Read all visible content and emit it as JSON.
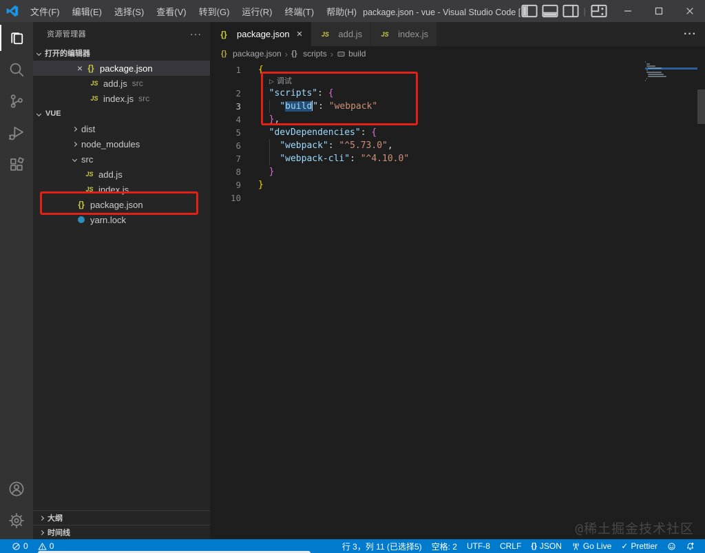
{
  "window": {
    "title": "package.json - vue - Visual Studio Code [管理员]"
  },
  "title_bar": {
    "menus": [
      {
        "key": "file",
        "label": "文件(F)"
      },
      {
        "key": "edit",
        "label": "编辑(E)"
      },
      {
        "key": "selection",
        "label": "选择(S)"
      },
      {
        "key": "view",
        "label": "查看(V)"
      },
      {
        "key": "go",
        "label": "转到(G)"
      },
      {
        "key": "run",
        "label": "运行(R)"
      },
      {
        "key": "terminal",
        "label": "终端(T)"
      },
      {
        "key": "help",
        "label": "帮助(H)"
      }
    ],
    "layout_icons": [
      "layout-sidebar-left-icon",
      "layout-panel-icon",
      "layout-sidebar-right-icon",
      "separator",
      "layout-customize-icon"
    ],
    "window_controls": [
      {
        "name": "minimize-button",
        "icon": "minimize-icon"
      },
      {
        "name": "maximize-button",
        "icon": "maximize-icon"
      },
      {
        "name": "close-button",
        "icon": "window-close-icon"
      }
    ]
  },
  "activity_bar": {
    "top": [
      {
        "name": "explorer",
        "icon": "files-icon",
        "active": true
      },
      {
        "name": "search",
        "icon": "search-icon",
        "active": false
      },
      {
        "name": "source-control",
        "icon": "source-control-icon",
        "active": false
      },
      {
        "name": "run-debug",
        "icon": "debug-icon",
        "active": false
      },
      {
        "name": "extensions",
        "icon": "extensions-icon",
        "active": false
      }
    ],
    "bottom": [
      {
        "name": "accounts",
        "icon": "account-icon"
      },
      {
        "name": "settings",
        "icon": "gear-icon"
      }
    ]
  },
  "sidebar": {
    "title": "资源管理器",
    "more_label": "···",
    "open_editors": {
      "header": "打开的编辑器",
      "items": [
        {
          "icon": "json",
          "label": "package.json",
          "selected": true,
          "closable": true,
          "desc": ""
        },
        {
          "icon": "js",
          "label": "add.js",
          "selected": false,
          "closable": false,
          "desc": "src"
        },
        {
          "icon": "js",
          "label": "index.js",
          "selected": false,
          "closable": false,
          "desc": "src"
        }
      ]
    },
    "tree": {
      "header": "VUE",
      "items": [
        {
          "kind": "folder",
          "label": "dist",
          "expanded": false,
          "level": 0
        },
        {
          "kind": "folder",
          "label": "node_modules",
          "expanded": false,
          "level": 0
        },
        {
          "kind": "folder",
          "label": "src",
          "expanded": true,
          "level": 0
        },
        {
          "kind": "file",
          "icon": "js",
          "label": "add.js",
          "level": 1
        },
        {
          "kind": "file",
          "icon": "js",
          "label": "index.js",
          "level": 1
        },
        {
          "kind": "file",
          "icon": "json",
          "label": "package.json",
          "level": 0,
          "annotated": true
        },
        {
          "kind": "file",
          "icon": "yarn",
          "label": "yarn.lock",
          "level": 0
        }
      ]
    },
    "bottom_sections": [
      {
        "label": "大纲"
      },
      {
        "label": "时间线"
      }
    ]
  },
  "editor": {
    "tabs": [
      {
        "icon": "json",
        "label": "package.json",
        "active": true,
        "closable": true
      },
      {
        "icon": "js",
        "label": "add.js",
        "active": false,
        "closable": false
      },
      {
        "icon": "js",
        "label": "index.js",
        "active": false,
        "closable": false
      }
    ],
    "tab_actions": [
      "split-editor-icon",
      "more-actions-icon"
    ],
    "breadcrumb": [
      {
        "icon": "json-icon",
        "label": "package.json"
      },
      {
        "icon": "object-icon",
        "label": "scripts"
      },
      {
        "icon": "symbol-icon",
        "label": "build"
      }
    ],
    "codelens": {
      "icon": "play-icon",
      "label": "调试"
    },
    "code_lines": [
      {
        "num": 1,
        "tokens": [
          {
            "t": "{",
            "c": "b1"
          }
        ]
      },
      {
        "num": 2,
        "tokens": [
          {
            "t": "  "
          },
          {
            "t": "\"scripts\"",
            "c": "key"
          },
          {
            "t": ": "
          },
          {
            "t": "{",
            "c": "b2"
          }
        ]
      },
      {
        "num": 3,
        "active": true,
        "guide": true,
        "tokens": [
          {
            "t": "    "
          },
          {
            "t": "\"",
            "c": "key"
          },
          {
            "t": "build",
            "c": "key",
            "sel": true
          },
          {
            "t": "",
            "caret": true
          },
          {
            "t": "\"",
            "c": "key"
          },
          {
            "t": ": "
          },
          {
            "t": "\"webpack\"",
            "c": "str"
          }
        ]
      },
      {
        "num": 4,
        "tokens": [
          {
            "t": "  "
          },
          {
            "t": "}",
            "c": "b2"
          },
          {
            "t": ","
          }
        ]
      },
      {
        "num": 5,
        "tokens": [
          {
            "t": "  "
          },
          {
            "t": "\"devDependencies\"",
            "c": "key"
          },
          {
            "t": ": "
          },
          {
            "t": "{",
            "c": "b2"
          }
        ]
      },
      {
        "num": 6,
        "guide": true,
        "tokens": [
          {
            "t": "    "
          },
          {
            "t": "\"webpack\"",
            "c": "key"
          },
          {
            "t": ": "
          },
          {
            "t": "\"^5.73.0\"",
            "c": "str"
          },
          {
            "t": ","
          }
        ]
      },
      {
        "num": 7,
        "guide": true,
        "tokens": [
          {
            "t": "    "
          },
          {
            "t": "\"webpack-cli\"",
            "c": "key"
          },
          {
            "t": ": "
          },
          {
            "t": "\"^4.10.0\"",
            "c": "str"
          }
        ]
      },
      {
        "num": 8,
        "tokens": [
          {
            "t": "  "
          },
          {
            "t": "}",
            "c": "b2"
          }
        ]
      },
      {
        "num": 9,
        "tokens": [
          {
            "t": "}",
            "c": "b1"
          }
        ]
      },
      {
        "num": 10,
        "tokens": []
      }
    ],
    "watermark": "@稀土掘金技术社区"
  },
  "status_bar": {
    "left": [
      {
        "name": "problems-errors",
        "icon": "error-icon",
        "label": "0"
      },
      {
        "name": "problems-warnings",
        "icon": "warning-icon",
        "label": "0"
      }
    ],
    "right": [
      {
        "name": "cursor-position",
        "icon": "",
        "label": "行 3，列 11 (已选择5)"
      },
      {
        "name": "indentation",
        "icon": "",
        "label": "空格: 2"
      },
      {
        "name": "encoding",
        "icon": "",
        "label": "UTF-8"
      },
      {
        "name": "eol",
        "icon": "",
        "label": "CRLF"
      },
      {
        "name": "language-mode",
        "icon": "braces-icon",
        "label": "JSON"
      },
      {
        "name": "go-live",
        "icon": "broadcast-icon",
        "label": "Go Live"
      },
      {
        "name": "prettier",
        "icon": "check-icon",
        "label": "Prettier"
      },
      {
        "name": "feedback",
        "icon": "feedback-icon",
        "label": ""
      },
      {
        "name": "notifications",
        "icon": "bell-dot-icon",
        "label": ""
      }
    ]
  },
  "colors": {
    "status_bar": "#007acc",
    "annotation_red": "#e32119",
    "selection": "#264f78",
    "json_key": "#9cdcfe",
    "json_string": "#ce9178",
    "bracket_outer": "#ffd700",
    "bracket_inner": "#da70d6",
    "file_icon_yellow": "#cbcb41",
    "yarn_icon_blue": "#2c8ebb"
  }
}
